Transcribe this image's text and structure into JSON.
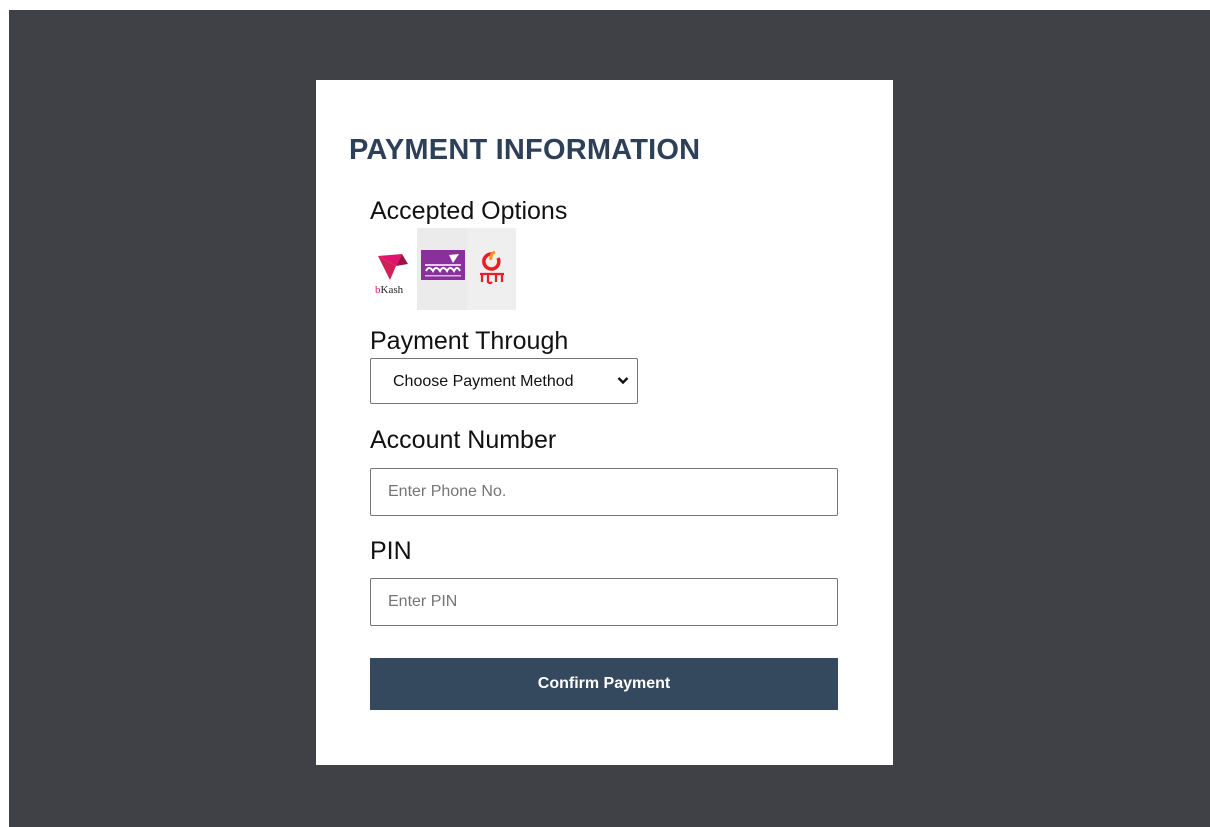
{
  "form": {
    "title": "PAYMENT INFORMATION",
    "accepted_label": "Accepted Options",
    "logos": [
      {
        "name": "bkash-logo",
        "text": "bKash",
        "color": "#e2136e"
      },
      {
        "name": "rocket-logo",
        "color": "#8b2f9f"
      },
      {
        "name": "nagad-logo",
        "text": "নগদ",
        "color": "#ec1c24"
      }
    ],
    "payment_label": "Payment Through",
    "payment_select": {
      "selected": "Choose Payment Method"
    },
    "account_label": "Account Number",
    "account_placeholder": "Enter Phone No.",
    "pin_label": "PIN",
    "pin_placeholder": "Enter PIN",
    "confirm_button": "Confirm Payment"
  },
  "colors": {
    "backdrop": "#3f4146",
    "title": "#2e4057",
    "button": "#34495e"
  }
}
